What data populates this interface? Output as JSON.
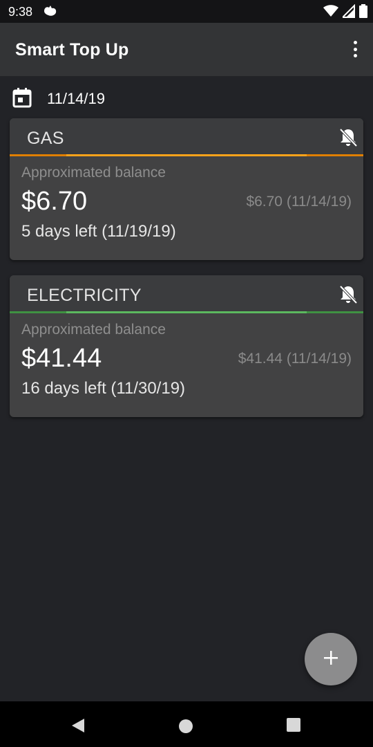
{
  "status_bar": {
    "time": "9:38",
    "icons": [
      "app-notification-icon",
      "wifi-icon",
      "signal-icon",
      "battery-icon"
    ]
  },
  "app_bar": {
    "title": "Smart Top Up",
    "menu_icon": "more-vert-icon"
  },
  "date_row": {
    "icon": "calendar-icon",
    "date": "11/14/19"
  },
  "cards": [
    {
      "title": "GAS",
      "accent_color": "#f08c00",
      "accent_highlight_color": "#ffa31a",
      "bell_icon": "bell-off-icon",
      "balance_label": "Approximated balance",
      "balance": "$6.70",
      "reading": "$6.70 (11/14/19)",
      "days_left": "5 days left (11/19/19)"
    },
    {
      "title": "ELECTRICITY",
      "accent_color": "#3f9142",
      "accent_highlight_color": "#5cb85f",
      "bell_icon": "bell-off-icon",
      "balance_label": "Approximated balance",
      "balance": "$41.44",
      "reading": "$41.44 (11/14/19)",
      "days_left": "16 days left (11/30/19)"
    }
  ],
  "fab": {
    "icon": "plus-icon"
  },
  "nav_bar": {
    "icons": [
      "back-icon",
      "home-icon",
      "recents-icon"
    ]
  }
}
